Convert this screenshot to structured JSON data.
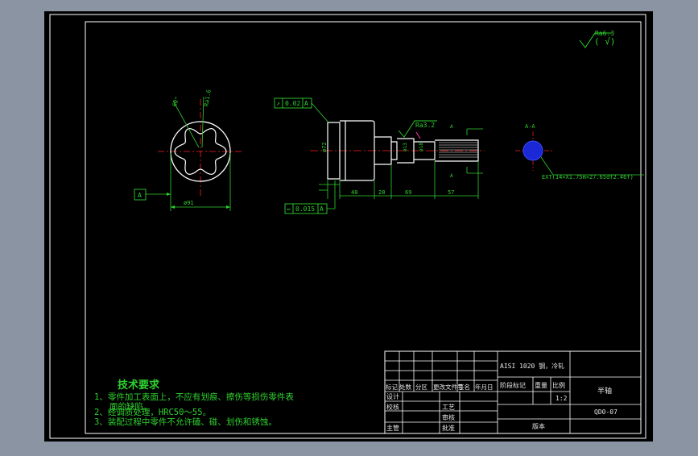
{
  "colors": {
    "background": "#8a94a3",
    "paper": "#000000",
    "frame": "#ffffff",
    "dimension": "#2fd12f",
    "part": "#ffffff",
    "centerline": "#ff2020",
    "accent": "#ff2aa0",
    "spline_section": "#1a28d6"
  },
  "roughness": {
    "global_label": "Ra6.3",
    "global_suffix": "( √)",
    "local_label": "Ra3.2"
  },
  "end_view": {
    "dia_label": "ø91",
    "datum": "A",
    "angle_label": "60°",
    "small_label": "Ra1.6"
  },
  "side_view": {
    "runout_label": "0.02",
    "runout_datum": "A",
    "flatness_label": "0.015",
    "flatness_datum": "A",
    "dims": [
      "40",
      "28",
      "69",
      "57"
    ],
    "vertical_dims": [
      "ø72",
      "ø13",
      "ø18"
    ],
    "section_mark": "A"
  },
  "section": {
    "title": "A-A",
    "spline_label": "EXT(14×X1.75m×27.65df2.46f)"
  },
  "tech_requirements": {
    "title": "技术要求",
    "items": [
      "1、零件加工表面上，不应有划痕、擦伤等损伤零件表",
      "面的缺陷。",
      "2、经调质处理，HRC50～55。",
      "3、装配过程中零件不允许磕、碰、划伤和锈蚀。"
    ]
  },
  "title_block": {
    "material": "AISI 1020 钢，冷轧",
    "header_row": [
      "标记",
      "处数",
      "分区",
      "更改文件号",
      "签名",
      "年月日"
    ],
    "stage_headers": [
      "阶段标记",
      "重量",
      "比例"
    ],
    "scale": "1:2",
    "part_name": "半轴",
    "drawing_no": "QD0-07",
    "version_label": "版本",
    "roles_left": [
      "设计",
      "校核",
      "主管"
    ],
    "roles_right": [
      "工艺",
      "审核",
      "批准"
    ]
  }
}
